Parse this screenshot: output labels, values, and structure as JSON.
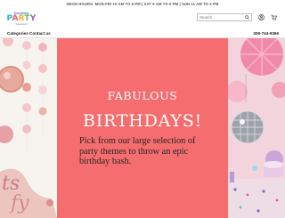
{
  "announcement": "NEON HOURS: MON-FRI 10 AM TO 6 PM | SAT 9 AM TO 5 PM | SUN 11 AM TO 4 PM",
  "logo": {
    "small": "Everything",
    "main": [
      "P",
      "A",
      "R",
      "T",
      "Y"
    ],
    "tag": "Superstore"
  },
  "search": {
    "placeholder": "Search"
  },
  "nav": {
    "categories": "Categories",
    "contact": "Contact us",
    "phone": "309-744-9366"
  },
  "hero": {
    "headline1": "FABULOUS",
    "headline2": "BIRTHDAYS!",
    "subtext": "Pick from our large selection of party themes to throw an epic birthday bash.",
    "accent_color": "#f56d6e"
  },
  "icons": [
    "search-icon",
    "user-icon",
    "cart-icon"
  ]
}
